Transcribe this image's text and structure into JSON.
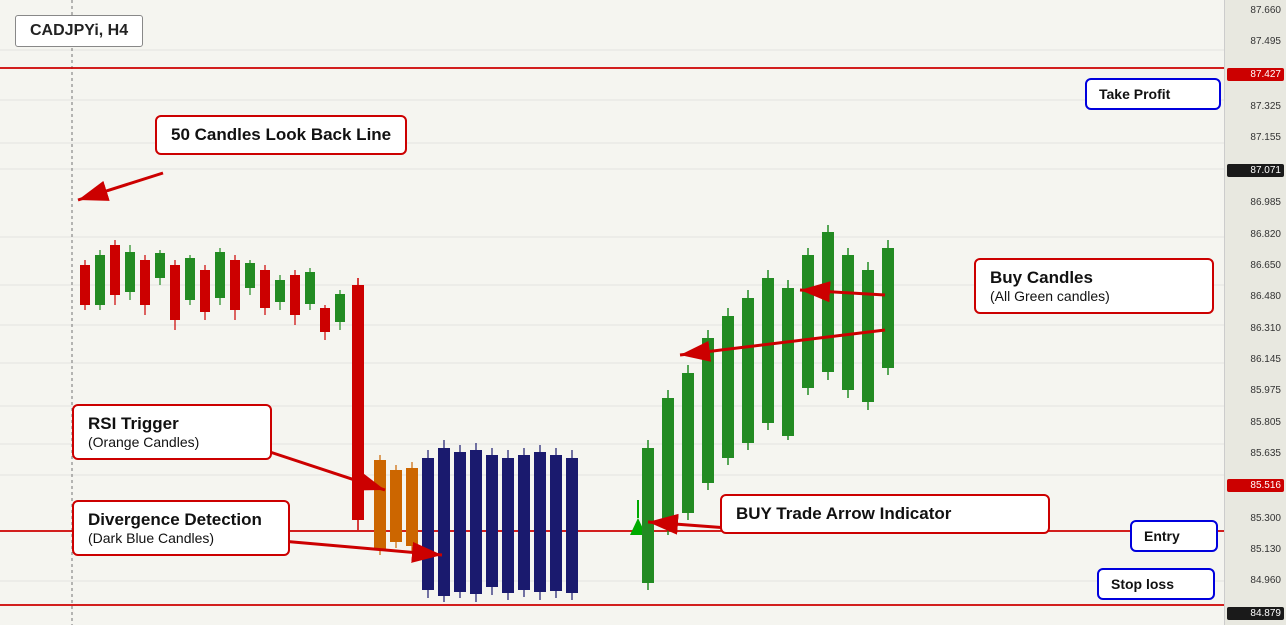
{
  "chart": {
    "symbol": "CADJPYi, H4",
    "price_levels": [
      {
        "value": "87.660",
        "y_pct": 2
      },
      {
        "value": "87.495",
        "y_pct": 8
      },
      {
        "value": "87.427",
        "y_pct": 11,
        "highlighted": true,
        "color": "#cc0000"
      },
      {
        "value": "87.325",
        "y_pct": 16
      },
      {
        "value": "87.155",
        "y_pct": 23
      },
      {
        "value": "87.071",
        "y_pct": 27,
        "current": true
      },
      {
        "value": "86.985",
        "y_pct": 31
      },
      {
        "value": "86.820",
        "y_pct": 38
      },
      {
        "value": "86.650",
        "y_pct": 45
      },
      {
        "value": "86.480",
        "y_pct": 52
      },
      {
        "value": "86.310",
        "y_pct": 58
      },
      {
        "value": "86.145",
        "y_pct": 65
      },
      {
        "value": "85.975",
        "y_pct": 71
      },
      {
        "value": "85.805",
        "y_pct": 76
      },
      {
        "value": "85.635",
        "y_pct": 81
      },
      {
        "value": "85.516",
        "y_pct": 85,
        "entry": true,
        "color": "#cc0000"
      },
      {
        "value": "85.300",
        "y_pct": 89
      },
      {
        "value": "85.130",
        "y_pct": 93
      },
      {
        "value": "84.960",
        "y_pct": 97
      },
      {
        "value": "84.879",
        "y_pct": 100,
        "stop": true
      }
    ],
    "annotations": {
      "look_back_line": "50 Candles Look Back Line",
      "buy_candles_title": "Buy Candles",
      "buy_candles_subtitle": "(All Green candles)",
      "rsi_trigger_title": "RSI Trigger",
      "rsi_trigger_subtitle": "(Orange Candles)",
      "divergence_title": "Divergence Detection",
      "divergence_subtitle": "(Dark Blue Candles)",
      "buy_arrow": "BUY Trade Arrow Indicator",
      "take_profit": "Take Profit",
      "entry": "Entry",
      "stop_loss": "Stop loss"
    }
  }
}
